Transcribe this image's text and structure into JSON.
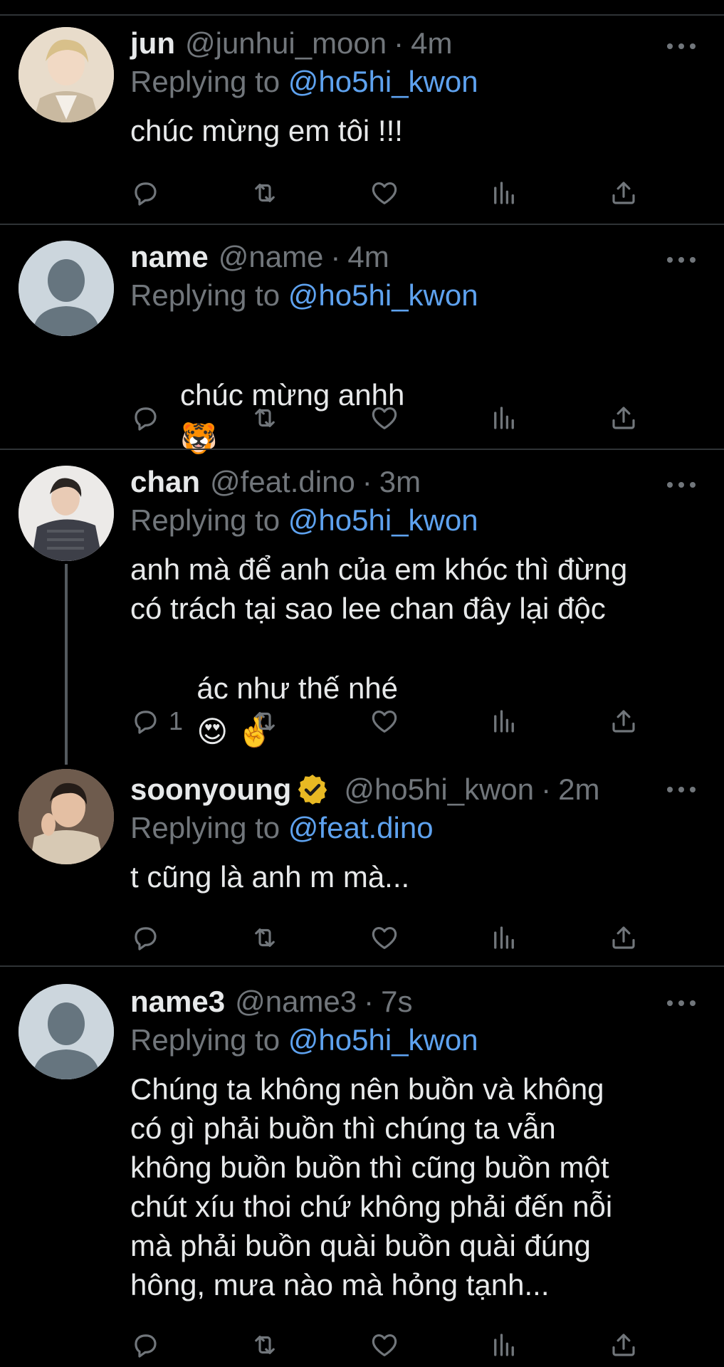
{
  "tweets": [
    {
      "display_name": "jun",
      "handle": "@junhui_moon",
      "time": "4m",
      "replying_label": "Replying to",
      "replying_to": "@ho5hi_kwon",
      "text": "chúc mừng em tôi !!!",
      "reply_count": ""
    },
    {
      "display_name": "name",
      "handle": "@name",
      "time": "4m",
      "replying_label": "Replying to",
      "replying_to": "@ho5hi_kwon",
      "text": "chúc mừng anhh",
      "emoji": "🐯",
      "reply_count": ""
    },
    {
      "display_name": "chan",
      "handle": "@feat.dino",
      "time": "3m",
      "replying_label": "Replying to",
      "replying_to": "@ho5hi_kwon",
      "text_lines": [
        "anh mà để anh của em khóc thì đừng",
        "có trách tại sao lee chan đây lại độc",
        "ác như thế nhé"
      ],
      "emoji": "😍 🤞",
      "reply_count": "1"
    },
    {
      "display_name": "soonyoung",
      "verified": true,
      "handle": "@ho5hi_kwon",
      "time": "2m",
      "replying_label": "Replying to",
      "replying_to": "@feat.dino",
      "text": "t cũng là anh m mà...",
      "reply_count": ""
    },
    {
      "display_name": "name3",
      "handle": "@name3",
      "time": "7s",
      "replying_label": "Replying to",
      "replying_to": "@ho5hi_kwon",
      "text_lines": [
        "Chúng ta không nên buồn và không",
        "có gì phải buồn thì chúng ta vẫn",
        "không buồn buồn thì cũng buồn một",
        "chút xíu thoi chứ không phải đến nỗi",
        "mà phải buồn quài buồn quài đúng",
        "hông, mưa nào mà hỏng tạnh..."
      ],
      "reply_count": ""
    }
  ],
  "separator": "·",
  "icons": {
    "reply": "reply-icon",
    "retweet": "retweet-icon",
    "like": "heart-icon",
    "views": "analytics-icon",
    "share": "share-icon",
    "more": "more-icon",
    "verified": "verified-badge-icon"
  },
  "colors": {
    "background": "#000000",
    "text": "#e7e9ea",
    "muted": "#71767b",
    "link": "#5ea2ef",
    "verified": "#e8b923"
  }
}
